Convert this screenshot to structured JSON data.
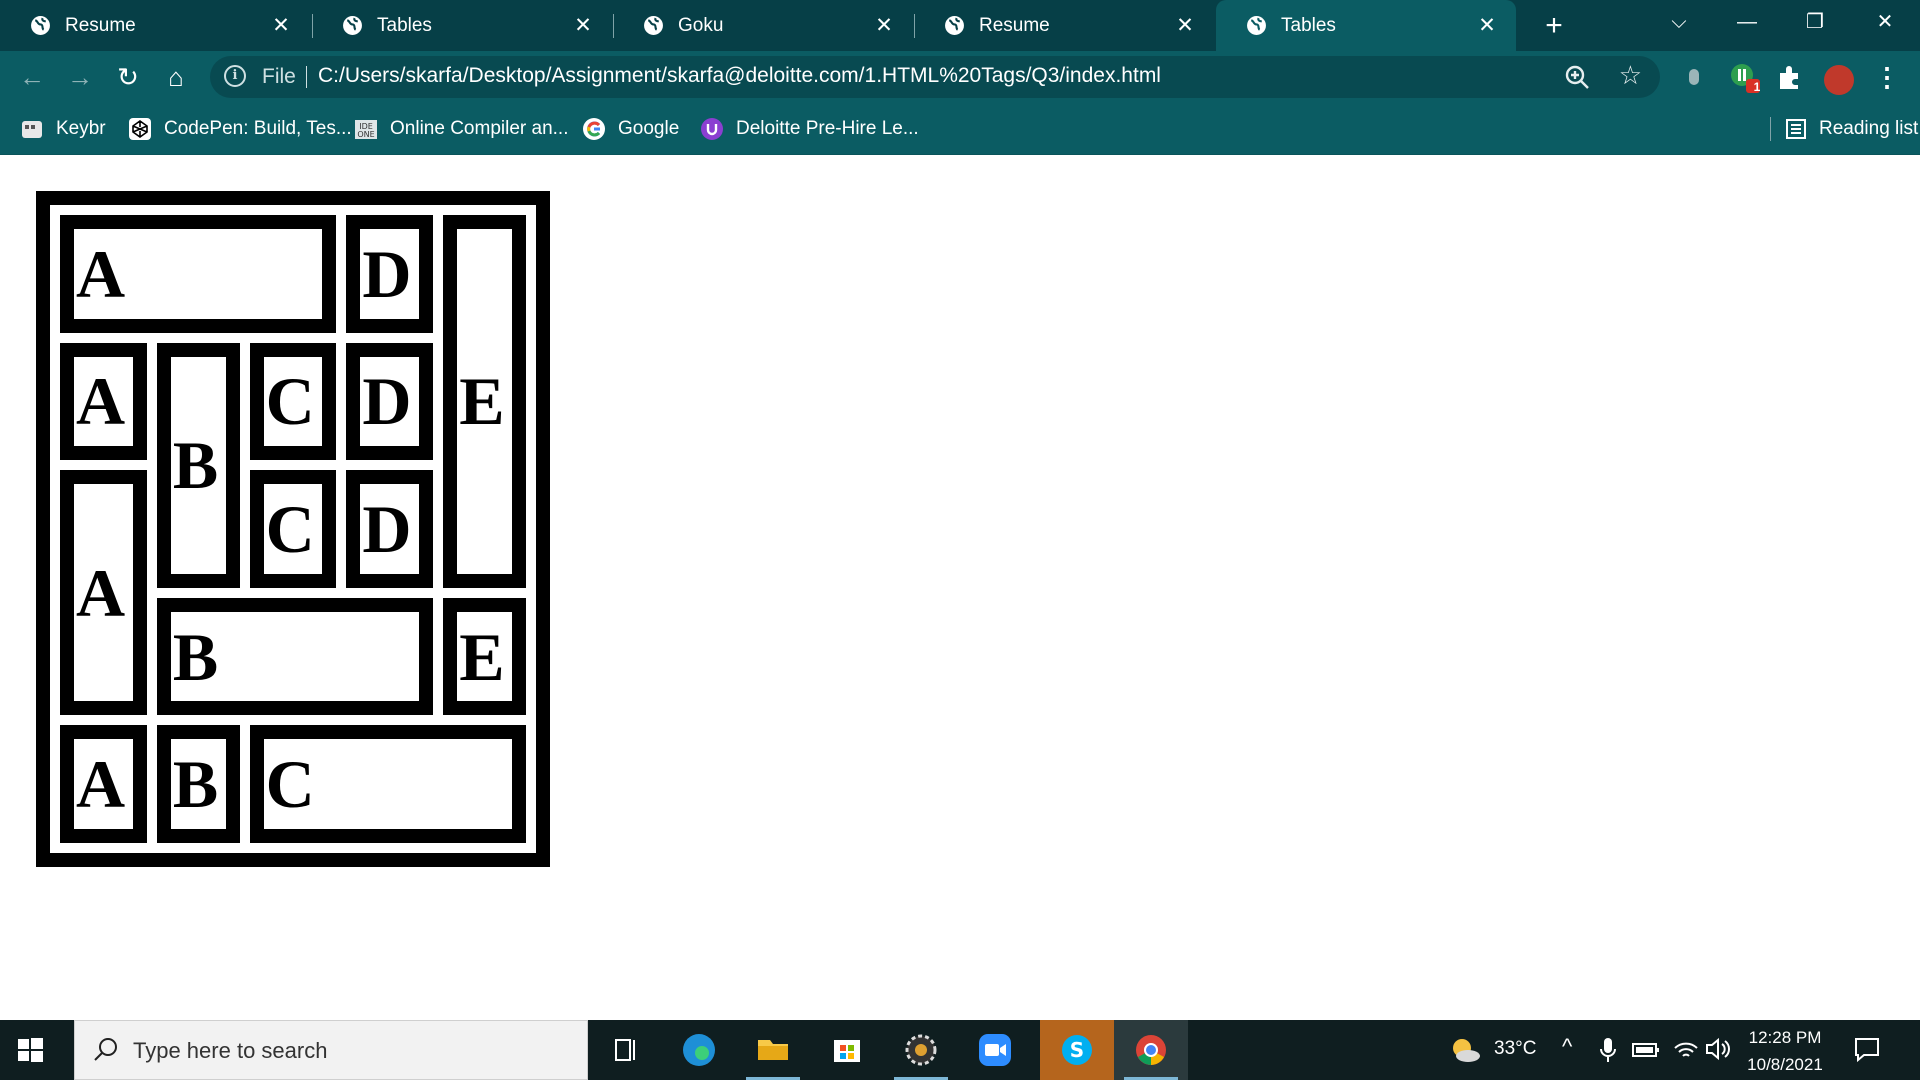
{
  "browser": {
    "tabs": [
      {
        "title": "Resume",
        "active": false
      },
      {
        "title": "Tables",
        "active": false
      },
      {
        "title": "Goku",
        "active": false
      },
      {
        "title": "Resume",
        "active": false
      },
      {
        "title": "Tables",
        "active": true
      }
    ],
    "address": {
      "scheme_label": "File",
      "url": "C:/Users/skarfa/Desktop/Assignment/skarfa@deloitte.com/1.HTML%20Tags/Q3/index.html"
    },
    "extension_badge": "1",
    "bookmarks": [
      {
        "label": "Keybr",
        "icon": "keybr-icon"
      },
      {
        "label": "CodePen: Build, Tes...",
        "icon": "codepen-icon"
      },
      {
        "label": "Online Compiler an...",
        "icon": "ideone-icon"
      },
      {
        "label": "Google",
        "icon": "google-icon"
      },
      {
        "label": "Deloitte Pre-Hire Le...",
        "icon": "deloitte-icon"
      }
    ],
    "reading_list": "Reading list"
  },
  "page": {
    "table_rows": [
      [
        "A",
        "D",
        "E"
      ],
      [
        "A",
        "B",
        "C",
        "D"
      ],
      [
        "C",
        "D"
      ],
      [
        "A",
        "B",
        "E"
      ],
      [
        "A",
        "B",
        "C"
      ]
    ]
  },
  "taskbar": {
    "search_placeholder": "Type here to search",
    "weather": "33°C",
    "time": "12:28 PM",
    "date": "10/8/2021"
  },
  "colors": {
    "tabstrip": "#063f47",
    "toolbar": "#0b5c63",
    "taskbar": "#0f1e20",
    "table_border": "#000000"
  }
}
